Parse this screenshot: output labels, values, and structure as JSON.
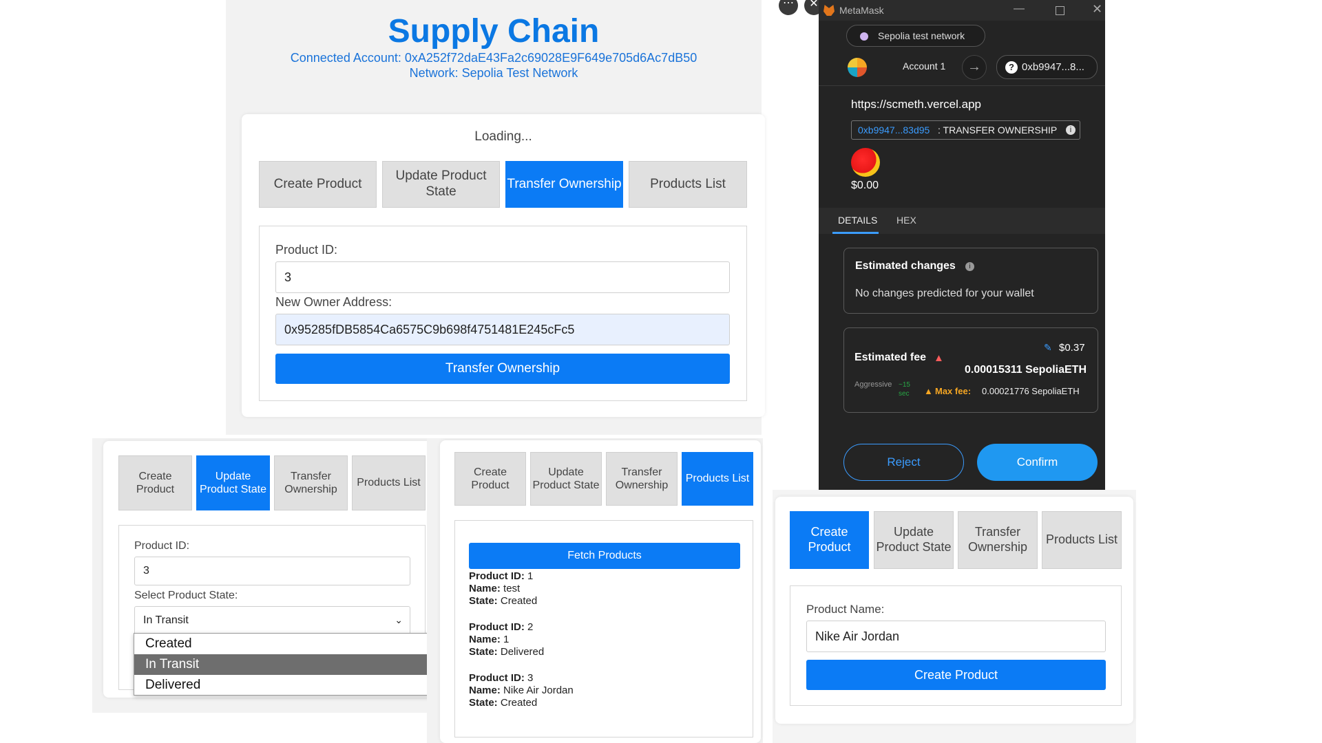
{
  "app": {
    "title": "Supply Chain",
    "connected_account": "Connected Account: 0xA252f72daE43Fa2c69028E9F649e705d6Ac7dB50",
    "network": "Network: Sepolia Test Network",
    "loading": "Loading..."
  },
  "tabs": {
    "create": "Create Product",
    "update": "Update Product State",
    "transfer": "Transfer Ownership",
    "list": "Products List"
  },
  "transfer_form": {
    "product_id_label": "Product ID:",
    "product_id_value": "3",
    "new_owner_label": "New Owner Address:",
    "new_owner_value": "0x95285fDB5854Ca6575C9b698f4751481E245cFc5",
    "submit_label": "Transfer Ownership"
  },
  "update_form": {
    "product_id_label": "Product ID:",
    "product_id_value": "3",
    "state_label": "Select Product State:",
    "state_value": "In Transit",
    "options": [
      "Created",
      "In Transit",
      "Delivered"
    ]
  },
  "products_panel": {
    "fetch_label": "Fetch Products",
    "id_key": "Product ID:",
    "name_key": "Name:",
    "state_key": "State:",
    "products": [
      {
        "id": "1",
        "name": "test",
        "state": "Created"
      },
      {
        "id": "2",
        "name": "1",
        "state": "Delivered"
      },
      {
        "id": "3",
        "name": "Nike Air Jordan",
        "state": "Created"
      }
    ]
  },
  "create_form": {
    "name_label": "Product Name:",
    "name_value": "Nike Air Jordan",
    "submit_label": "Create Product"
  },
  "metamask": {
    "window_title": "MetaMask",
    "network": "Sepolia test network",
    "account": "Account 1",
    "address_short": "0xb9947...8...",
    "site": "https://scmeth.vercel.app",
    "contract_short": "0xb9947...83d95",
    "method": ": TRANSFER OWNERSHIP",
    "balance": "$0.00",
    "tab_details": "DETAILS",
    "tab_hex": "HEX",
    "est_changes_title": "Estimated changes",
    "est_changes_text": "No changes predicted for your wallet",
    "est_fee_title": "Estimated fee",
    "fee_usd": "$0.37",
    "fee_eth": "0.00015311 SepoliaETH",
    "speed": "Aggressive",
    "speed_time": "~15 sec",
    "max_fee_label": "Max fee:",
    "max_fee_value": "0.00021776 SepoliaETH",
    "reject": "Reject",
    "confirm": "Confirm"
  }
}
